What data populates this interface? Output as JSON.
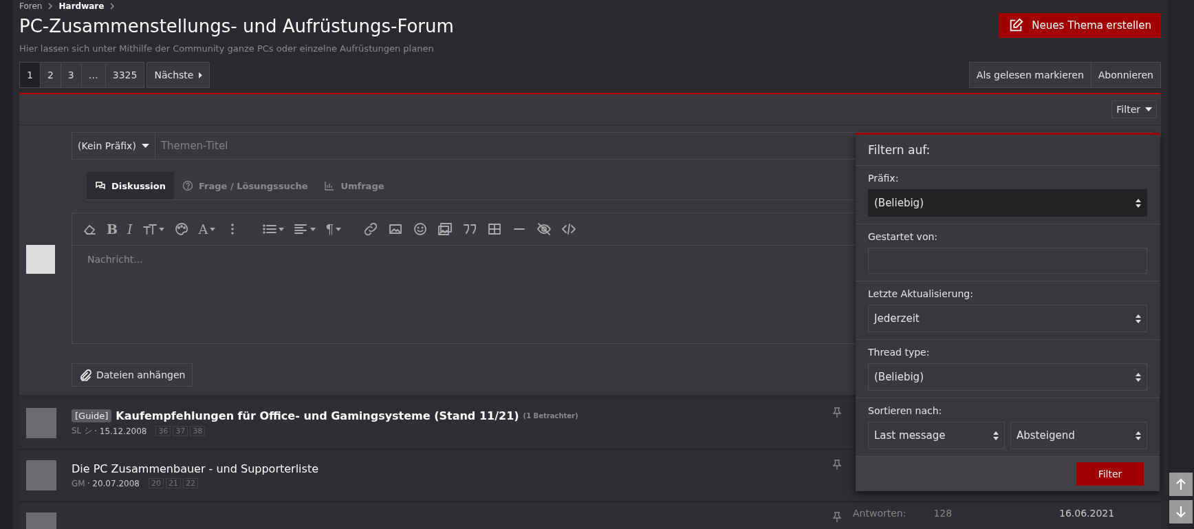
{
  "breadcrumb": [
    {
      "label": "Foren"
    },
    {
      "label": "Hardware"
    }
  ],
  "title": "PC-Zusammenstellungs- und Aufrüstungs-Forum",
  "description": "Hier lassen sich unter Mithilfe der Community ganze PCs oder einzelne Aufrüstungen planen",
  "new_thread_button": "Neues Thema erstellen",
  "pagination": {
    "pages": [
      {
        "label": "1",
        "selected": true
      },
      {
        "label": "2",
        "selected": false
      },
      {
        "label": "3",
        "selected": false
      },
      {
        "label": "…",
        "selected": false
      },
      {
        "label": "3325",
        "selected": false
      }
    ],
    "next": "Nächste"
  },
  "actions": [
    "Als gelesen markieren",
    "Abonnieren"
  ],
  "filter_toggle": "Filter",
  "quick_thread": {
    "prefix_select": "(Kein Präfix)",
    "title_placeholder": "Themen-Titel",
    "tabs": [
      {
        "label": "Diskussion",
        "selected": true
      },
      {
        "label": "Frage / Lösungssuche",
        "selected": false
      },
      {
        "label": "Umfrage",
        "selected": false
      }
    ],
    "toolbar": [
      {
        "kind": "eraser"
      },
      {
        "kind": "bold",
        "text": "B"
      },
      {
        "kind": "italic",
        "text": "I"
      },
      {
        "kind": "size"
      },
      {
        "kind": "palette"
      },
      {
        "kind": "color",
        "text": "A"
      },
      {
        "kind": "more"
      },
      {
        "kind": "list"
      },
      {
        "kind": "align"
      },
      {
        "kind": "paragraph",
        "text": "¶"
      },
      {
        "kind": "link"
      },
      {
        "kind": "image"
      },
      {
        "kind": "smile"
      },
      {
        "kind": "media"
      },
      {
        "kind": "quote"
      },
      {
        "kind": "table"
      },
      {
        "kind": "rule"
      },
      {
        "kind": "hidden"
      },
      {
        "kind": "code"
      }
    ],
    "message_placeholder": "Nachricht...",
    "attach_button": "Dateien anhängen"
  },
  "threads": [
    {
      "prefix": "[Guide]",
      "title": "Kaufempfehlungen für Office- und Gamingsysteme (Stand 11/21)",
      "viewers": "(1 Betrachter)",
      "unread": true,
      "pinned": true,
      "author": "SL シ",
      "date": "· 15.12.2008",
      "pages": [
        "36",
        "37",
        "38"
      ]
    },
    {
      "title": "Die PC Zusammenbauer - und Supporterliste",
      "unread": false,
      "pinned": true,
      "author": "GM",
      "date": "· 20.07.2008",
      "pages": [
        "20",
        "21",
        "22"
      ]
    },
    {
      "pinned": true,
      "replies_label": "Antworten:",
      "replies": "128",
      "last_date": "16.06.2021"
    }
  ],
  "filter_panel": {
    "title": "Filtern auf:",
    "fields": [
      {
        "kind": "select",
        "label": "Präfix:",
        "value": "(Beliebig)",
        "focused": true
      },
      {
        "kind": "input",
        "label": "Gestartet von:"
      },
      {
        "kind": "select",
        "label": "Letzte Aktualisierung:",
        "value": "Jederzeit",
        "focused": false
      },
      {
        "kind": "select",
        "label": "Thread type:",
        "value": "(Beliebig)",
        "focused": false
      },
      {
        "kind": "pair",
        "label": "Sortieren nach:",
        "values": [
          "Last message",
          "Absteigend"
        ]
      }
    ],
    "submit": "Filter"
  }
}
